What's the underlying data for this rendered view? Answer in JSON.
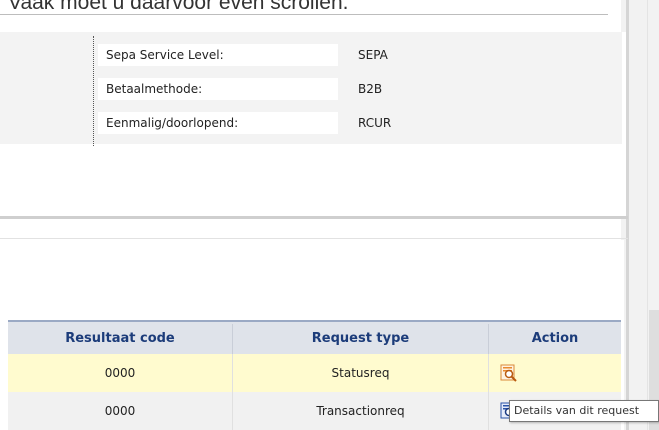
{
  "intro_text": "Vaak moet u daarvoor even scrollen.",
  "details": [
    {
      "label": "Sepa Service Level:",
      "value": "SEPA"
    },
    {
      "label": "Betaalmethode:",
      "value": "B2B"
    },
    {
      "label": "Eenmalig/doorlopend:",
      "value": "RCUR"
    }
  ],
  "table": {
    "columns": [
      "Resultaat code",
      "Request type",
      "Action"
    ],
    "rows": [
      {
        "resultaat_code": "0000",
        "request_type": "Statusreq",
        "action_icon": "magnifier-icon",
        "selected": true
      },
      {
        "resultaat_code": "0000",
        "request_type": "Transactionreq",
        "action_icon": "magnifier-icon",
        "selected": false
      }
    ]
  },
  "tooltip": "Details van dit request",
  "colors": {
    "header_text": "#1c3c7a",
    "header_bg": "#dfe3ea",
    "selected_row": "#fffbcf",
    "icon_orange": "#e88a2e",
    "icon_blue": "#2a54a8"
  }
}
